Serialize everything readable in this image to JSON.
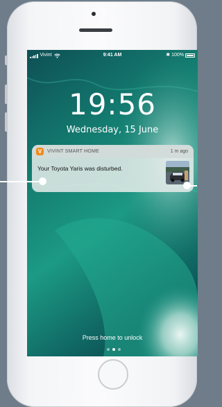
{
  "status_bar": {
    "carrier": "Vivint",
    "time": "9:41 AM",
    "battery": "100%"
  },
  "lock_screen": {
    "clock": "19:56",
    "date": "Wednesday, 15 June",
    "unlock_hint": "Press home to unlock"
  },
  "notification": {
    "app_icon_letter": "V",
    "app_name": "VIVINT SMART HOME",
    "time": "1 m ago",
    "message": "Your Toyota Yaris was disturbed."
  },
  "colors": {
    "app_accent": "#f08a1c",
    "background": "#6e7d89"
  },
  "icons": [
    "signal-icon",
    "wifi-icon",
    "bluetooth-icon",
    "battery-icon",
    "vivint-app-icon",
    "camera-thumbnail"
  ]
}
